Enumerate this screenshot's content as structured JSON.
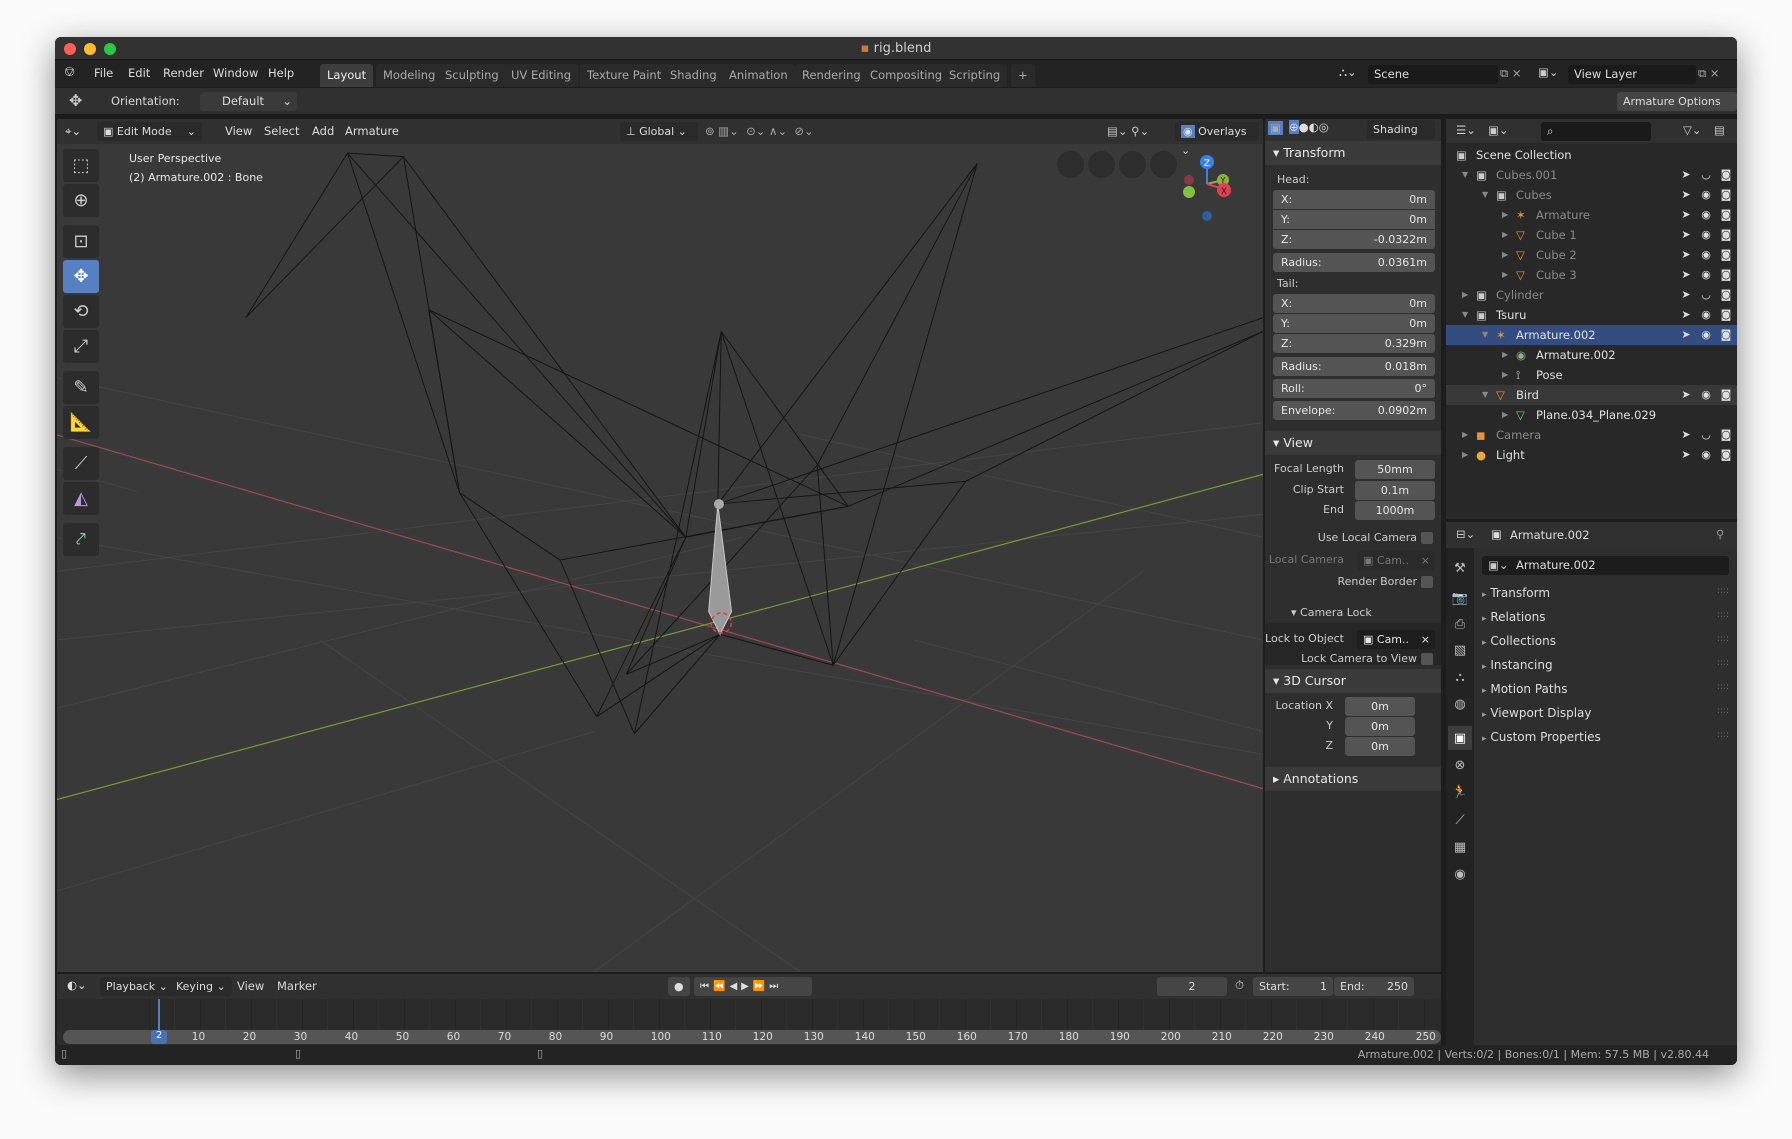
{
  "window": {
    "title": "rig.blend"
  },
  "menu": [
    "File",
    "Edit",
    "Render",
    "Window",
    "Help"
  ],
  "workspaces": [
    "Layout",
    "Modeling",
    "Sculpting",
    "UV Editing",
    "Texture Paint",
    "Shading",
    "Animation",
    "Rendering",
    "Compositing",
    "Scripting",
    "+"
  ],
  "scene": {
    "label": "Scene",
    "view_layer": "View Layer"
  },
  "tool_header": {
    "orientation_label": "Orientation:",
    "orientation_value": "Default",
    "armature_options": "Armature Options"
  },
  "viewport": {
    "mode": "Edit Mode",
    "menus": [
      "View",
      "Select",
      "Add",
      "Armature"
    ],
    "transform_orientation": "Global",
    "overlays": "Overlays",
    "shading": "Shading",
    "info_line1": "User Perspective",
    "info_line2": "(2) Armature.002 : Bone",
    "gizmo": {
      "z": "Z",
      "y": "Y",
      "x": "X"
    },
    "colors": {
      "x_axis": "#9a4a55",
      "y_axis": "#7a9a36",
      "background": "#393939",
      "active_tool": "#5680c2"
    },
    "tools": [
      "select-box",
      "cursor",
      "move-all",
      "move",
      "rotate",
      "scale",
      "annotate",
      "measure",
      "bone-roll",
      "bone-envelope",
      "extrude-bone"
    ]
  },
  "npanel": {
    "transform": {
      "title": "Transform",
      "head_label": "Head:",
      "tail_label": "Tail:",
      "head": [
        {
          "k": "X:",
          "v": "0m"
        },
        {
          "k": "Y:",
          "v": "0m"
        },
        {
          "k": "Z:",
          "v": "-0.0322m"
        }
      ],
      "head_radius": {
        "k": "Radius:",
        "v": "0.0361m"
      },
      "tail": [
        {
          "k": "X:",
          "v": "0m"
        },
        {
          "k": "Y:",
          "v": "0m"
        },
        {
          "k": "Z:",
          "v": "0.329m"
        }
      ],
      "tail_radius": {
        "k": "Radius:",
        "v": "0.018m"
      },
      "roll": {
        "k": "Roll:",
        "v": "0°"
      },
      "envelope": {
        "k": "Envelope:",
        "v": "0.0902m"
      }
    },
    "view": {
      "title": "View",
      "focal_length_label": "Focal Length",
      "focal_length": "50mm",
      "clip_start_label": "Clip Start",
      "clip_start": "0.1m",
      "end_label": "End",
      "end": "1000m",
      "use_local_camera": "Use Local Camera",
      "local_camera_label": "Local Camera",
      "local_camera": "Cam..",
      "render_border": "Render Border",
      "camera_lock": "Camera Lock",
      "lock_to_object_label": "Lock to Object",
      "lock_to_object": "Cam..",
      "lock_camera_to_view": "Lock Camera to View"
    },
    "cursor": {
      "title": "3D Cursor",
      "location_x_label": "Location X",
      "y_label": "Y",
      "z_label": "Z",
      "x": "0m",
      "y": "0m",
      "z": "0m"
    },
    "annotations": {
      "title": "Annotations"
    }
  },
  "outliner": {
    "rows": [
      {
        "label": "Scene Collection",
        "icon": "collection",
        "depth": 0
      },
      {
        "label": "Cubes.001",
        "icon": "collection",
        "depth": 1,
        "dim": true,
        "eye": "hidden"
      },
      {
        "label": "Cubes",
        "icon": "collection",
        "depth": 2,
        "dim": true
      },
      {
        "label": "Armature",
        "icon": "armature",
        "depth": 3,
        "dim": true
      },
      {
        "label": "Cube 1",
        "icon": "mesh",
        "depth": 3,
        "dim": true
      },
      {
        "label": "Cube 2",
        "icon": "mesh",
        "depth": 3,
        "dim": true
      },
      {
        "label": "Cube 3",
        "icon": "mesh",
        "depth": 3,
        "dim": true
      },
      {
        "label": "Cylinder",
        "icon": "collection",
        "depth": 1,
        "dim": true,
        "eye": "hidden"
      },
      {
        "label": "Tsuru",
        "icon": "collection",
        "depth": 1
      },
      {
        "label": "Armature.002",
        "icon": "armature",
        "depth": 2,
        "selected": true
      },
      {
        "label": "Armature.002",
        "icon": "armature-data",
        "depth": 3,
        "nocols": true
      },
      {
        "label": "Pose",
        "icon": "pose",
        "depth": 3,
        "nocols": true
      },
      {
        "label": "Bird",
        "icon": "mesh",
        "depth": 2,
        "highlight": true
      },
      {
        "label": "Plane.034_Plane.029",
        "icon": "mesh-data",
        "depth": 3,
        "nocols": true
      },
      {
        "label": "Camera",
        "icon": "camera",
        "depth": 1,
        "dim": true,
        "eye": "hidden"
      },
      {
        "label": "Light",
        "icon": "light",
        "depth": 1
      }
    ]
  },
  "properties": {
    "header_object": "Armature.002",
    "name_field": "Armature.002",
    "panels": [
      "Transform",
      "Relations",
      "Collections",
      "Instancing",
      "Motion Paths",
      "Viewport Display",
      "Custom Properties"
    ]
  },
  "timeline": {
    "menus": [
      "Playback",
      "Keying",
      "View",
      "Marker"
    ],
    "current_frame": "2",
    "start_label": "Start:",
    "start": "1",
    "end_label": "End:",
    "end": "250",
    "ticks": [
      "10",
      "20",
      "30",
      "40",
      "50",
      "60",
      "70",
      "80",
      "90",
      "100",
      "110",
      "120",
      "130",
      "140",
      "150",
      "160",
      "170",
      "180",
      "190",
      "200",
      "210",
      "220",
      "230",
      "240",
      "250"
    ]
  },
  "status": {
    "text": "Armature.002 | Verts:0/2 | Bones:0/1 | Mem: 57.5 MB | v2.80.44"
  }
}
